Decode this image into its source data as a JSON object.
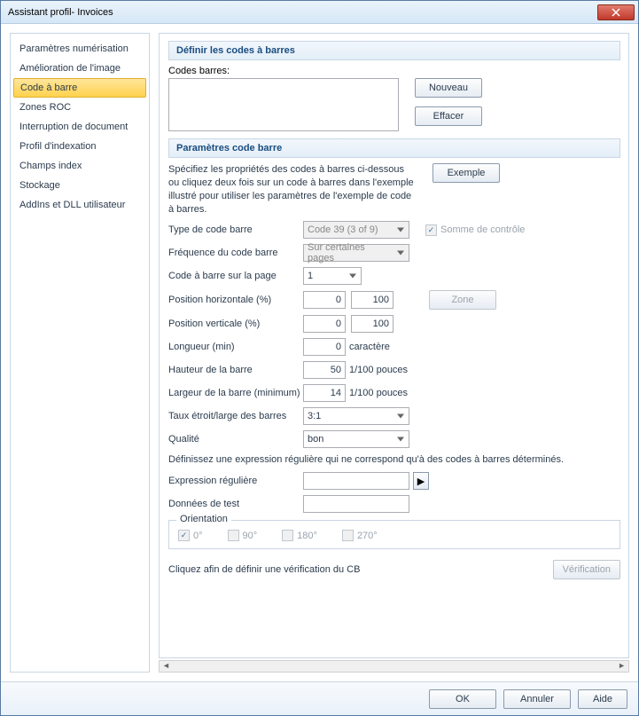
{
  "window": {
    "title": "Assistant profil- Invoices"
  },
  "sidebar": {
    "items": [
      {
        "label": "Paramètres numérisation"
      },
      {
        "label": "Amélioration de l'image"
      },
      {
        "label": "Code à barre",
        "selected": true
      },
      {
        "label": "Zones ROC"
      },
      {
        "label": "Interruption de document"
      },
      {
        "label": "Profil d'indexation"
      },
      {
        "label": "Champs index"
      },
      {
        "label": "Stockage"
      },
      {
        "label": "AddIns et DLL utilisateur"
      }
    ]
  },
  "section1": {
    "title": "Définir les codes à barres",
    "codes_label": "Codes barres:",
    "new_btn": "Nouveau",
    "clear_btn": "Effacer"
  },
  "section2": {
    "title": "Paramètres code barre",
    "desc": "Spécifiez les propriétés des codes à barres ci-dessous ou cliquez deux fois sur un code à barres dans l'exemple illustré pour utiliser les paramètres de l'exemple de code à barres.",
    "example_btn": "Exemple",
    "type_label": "Type de code barre",
    "type_value": "Code 39 (3 of 9)",
    "checksum_label": "Somme de contrôle",
    "freq_label": "Fréquence du code barre",
    "freq_value": "Sur certaines pages",
    "onpage_label": "Code à barre sur la page",
    "onpage_value": "1",
    "posh_label": "Position horizontale (%)",
    "posh_from": "0",
    "posh_to": "100",
    "zone_btn": "Zone",
    "posv_label": "Position verticale (%)",
    "posv_from": "0",
    "posv_to": "100",
    "len_label": "Longueur (min)",
    "len_value": "0",
    "len_unit": "caractère",
    "height_label": "Hauteur de la barre",
    "height_value": "50",
    "height_unit": "1/100 pouces",
    "width_label": "Largeur de la barre (minimum)",
    "width_value": "14",
    "width_unit": "1/100 pouces",
    "ratio_label": "Taux étroit/large des barres",
    "ratio_value": "3:1",
    "quality_label": "Qualité",
    "quality_value": "bon",
    "regex_desc": "Définissez une expression régulière qui ne correspond qu'à des codes à barres déterminés.",
    "regex_label": "Expression régulière",
    "testdata_label": "Données de test",
    "orientation_legend": "Orientation",
    "orient_0": "0°",
    "orient_90": "90°",
    "orient_180": "180°",
    "orient_270": "270°",
    "verify_desc": "Cliquez afin de définir une vérification du CB",
    "verify_btn": "Vérification"
  },
  "footer": {
    "ok": "OK",
    "cancel": "Annuler",
    "help": "Aide"
  }
}
